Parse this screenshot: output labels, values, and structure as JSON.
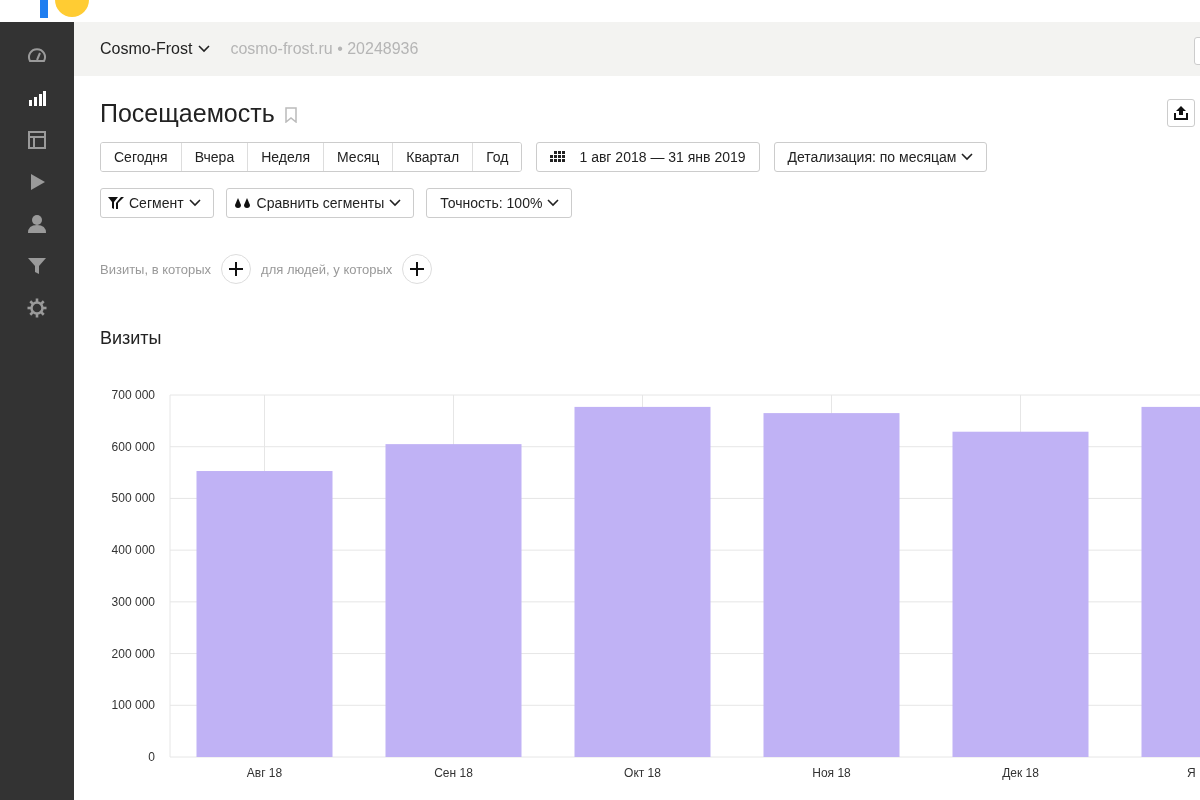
{
  "sidebar": {
    "items": [
      {
        "selected": false
      },
      {
        "selected": true
      },
      {
        "selected": false
      },
      {
        "selected": false
      },
      {
        "selected": false
      },
      {
        "selected": false
      },
      {
        "selected": false
      }
    ]
  },
  "header": {
    "counter_name": "Cosmo-Frost",
    "site": "cosmo-frost.ru",
    "separator": "•",
    "counter_id": "20248936"
  },
  "page": {
    "title": "Посещаемость"
  },
  "periods": [
    "Сегодня",
    "Вчера",
    "Неделя",
    "Месяц",
    "Квартал",
    "Год"
  ],
  "date_range": "1 авг 2018 — 31 янв 2019",
  "detail": "Детализация: по месяцам",
  "segment_buttons": [
    {
      "kind": "segment",
      "label": "Сегмент"
    },
    {
      "kind": "compare",
      "label": "Сравнить сегменты"
    },
    {
      "kind": "plain",
      "label": "Точность: 100%"
    }
  ],
  "conditions": [
    "Визиты, в которых",
    "для людей, у которых"
  ],
  "chart_data": {
    "type": "bar",
    "grid": true,
    "categories": [
      "Авг 18",
      "Сен 18",
      "Окт 18",
      "Ноя 18",
      "Дек 18",
      "Я"
    ],
    "series": [
      {
        "name": "Визиты",
        "color": "#c0b2f5",
        "values": [
          553000,
          605000,
          677000,
          665000,
          629000,
          677000
        ]
      }
    ],
    "ylim": [
      0,
      700000
    ],
    "yticks": [
      {
        "value": 0,
        "label": "0"
      },
      {
        "value": 100000,
        "label": "100 000"
      },
      {
        "value": 200000,
        "label": "200 000"
      },
      {
        "value": 300000,
        "label": "300 000"
      },
      {
        "value": 400000,
        "label": "400 000"
      },
      {
        "value": 500000,
        "label": "500 000"
      },
      {
        "value": 600000,
        "label": "600 000"
      },
      {
        "value": 700000,
        "label": "700 000"
      }
    ]
  }
}
